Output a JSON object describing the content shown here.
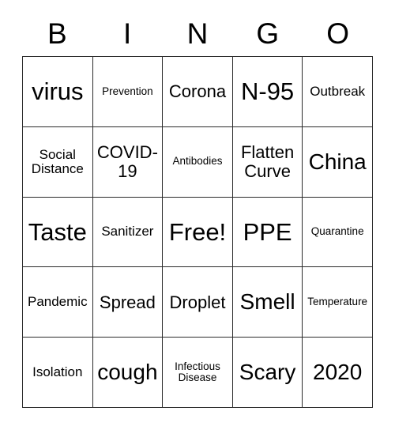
{
  "card": {
    "header_letters": [
      "B",
      "I",
      "N",
      "G",
      "O"
    ],
    "rows": [
      [
        {
          "text": "virus",
          "size": "size-xl"
        },
        {
          "text": "Prevention",
          "size": "size-xs"
        },
        {
          "text": "Corona",
          "size": "size-md"
        },
        {
          "text": "N-95",
          "size": "size-xl"
        },
        {
          "text": "Outbreak",
          "size": "size-sm"
        }
      ],
      [
        {
          "text": "Social Distance",
          "size": "size-sm"
        },
        {
          "text": "COVID-19",
          "size": "size-md"
        },
        {
          "text": "Antibodies",
          "size": "size-xs"
        },
        {
          "text": "Flatten Curve",
          "size": "size-md"
        },
        {
          "text": "China",
          "size": "size-lg"
        }
      ],
      [
        {
          "text": "Taste",
          "size": "size-xl"
        },
        {
          "text": "Sanitizer",
          "size": "size-sm"
        },
        {
          "text": "Free!",
          "size": "size-xl"
        },
        {
          "text": "PPE",
          "size": "size-xl"
        },
        {
          "text": "Quarantine",
          "size": "size-xs"
        }
      ],
      [
        {
          "text": "Pandemic",
          "size": "size-sm"
        },
        {
          "text": "Spread",
          "size": "size-md"
        },
        {
          "text": "Droplet",
          "size": "size-md"
        },
        {
          "text": "Smell",
          "size": "size-lg"
        },
        {
          "text": "Temperature",
          "size": "size-xs"
        }
      ],
      [
        {
          "text": "Isolation",
          "size": "size-sm"
        },
        {
          "text": "cough",
          "size": "size-lg"
        },
        {
          "text": "Infectious Disease",
          "size": "size-xs"
        },
        {
          "text": "Scary",
          "size": "size-lg"
        },
        {
          "text": "2020",
          "size": "size-lg"
        }
      ]
    ]
  },
  "colors": {
    "border": "#2b2b2b",
    "cell_background": "#ffffff",
    "text": "#000000"
  }
}
